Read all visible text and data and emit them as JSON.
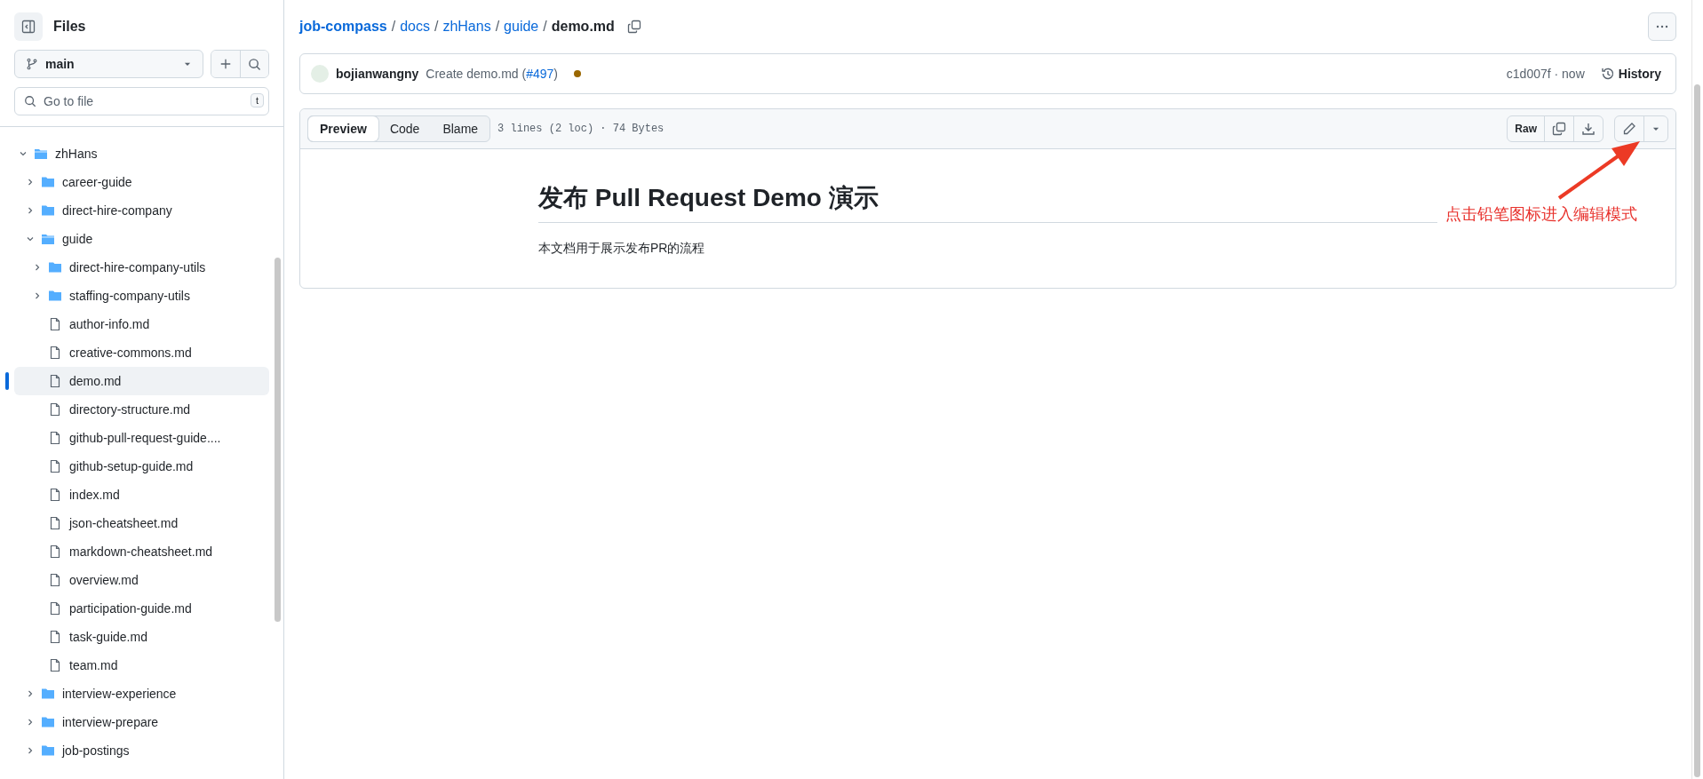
{
  "sidebar": {
    "title": "Files",
    "branch": "main",
    "search": {
      "placeholder": "Go to file",
      "shortcut": "t"
    },
    "tree": [
      {
        "name": "zhHans",
        "kind": "folder",
        "expanded": true,
        "selected": false,
        "children": [
          {
            "name": "career-guide",
            "kind": "folder",
            "expanded": false,
            "selected": false
          },
          {
            "name": "direct-hire-company",
            "kind": "folder",
            "expanded": false,
            "selected": false
          },
          {
            "name": "guide",
            "kind": "folder",
            "expanded": true,
            "selected": false,
            "children": [
              {
                "name": "direct-hire-company-utils",
                "kind": "folder",
                "expanded": false,
                "selected": false
              },
              {
                "name": "staffing-company-utils",
                "kind": "folder",
                "expanded": false,
                "selected": false
              },
              {
                "name": "author-info.md",
                "kind": "file",
                "selected": false
              },
              {
                "name": "creative-commons.md",
                "kind": "file",
                "selected": false
              },
              {
                "name": "demo.md",
                "kind": "file",
                "selected": true
              },
              {
                "name": "directory-structure.md",
                "kind": "file",
                "selected": false
              },
              {
                "name": "github-pull-request-guide....",
                "kind": "file",
                "selected": false
              },
              {
                "name": "github-setup-guide.md",
                "kind": "file",
                "selected": false
              },
              {
                "name": "index.md",
                "kind": "file",
                "selected": false
              },
              {
                "name": "json-cheatsheet.md",
                "kind": "file",
                "selected": false
              },
              {
                "name": "markdown-cheatsheet.md",
                "kind": "file",
                "selected": false
              },
              {
                "name": "overview.md",
                "kind": "file",
                "selected": false
              },
              {
                "name": "participation-guide.md",
                "kind": "file",
                "selected": false
              },
              {
                "name": "task-guide.md",
                "kind": "file",
                "selected": false
              },
              {
                "name": "team.md",
                "kind": "file",
                "selected": false
              }
            ]
          },
          {
            "name": "interview-experience",
            "kind": "folder",
            "expanded": false,
            "selected": false
          },
          {
            "name": "interview-prepare",
            "kind": "folder",
            "expanded": false,
            "selected": false
          },
          {
            "name": "job-postings",
            "kind": "folder",
            "expanded": false,
            "selected": false
          }
        ]
      }
    ]
  },
  "breadcrumb": [
    {
      "label": "job-compass",
      "kind": "repo"
    },
    {
      "label": "docs",
      "kind": "link",
      "separator": "/"
    },
    {
      "label": "zhHans",
      "kind": "link",
      "separator": "/"
    },
    {
      "label": "guide",
      "kind": "link",
      "separator": "/"
    },
    {
      "label": "demo.md",
      "kind": "current",
      "separator": "/"
    }
  ],
  "commit": {
    "author": "bojianwangny",
    "message": "Create demo.md (",
    "pr": "#497",
    "message_end": ")",
    "sha": "c1d007f · now",
    "history": "History"
  },
  "file": {
    "tabs": [
      {
        "label": "Preview",
        "selected": true
      },
      {
        "label": "Code",
        "selected": false
      },
      {
        "label": "Blame",
        "selected": false
      }
    ],
    "info": "3 lines (2 loc) · 74 Bytes",
    "raw": "Raw",
    "heading": "发布 Pull Request Demo 演示",
    "paragraph": "本文档用于展示发布PR的流程",
    "annotation": "点击铅笔图标进入编辑模式"
  }
}
